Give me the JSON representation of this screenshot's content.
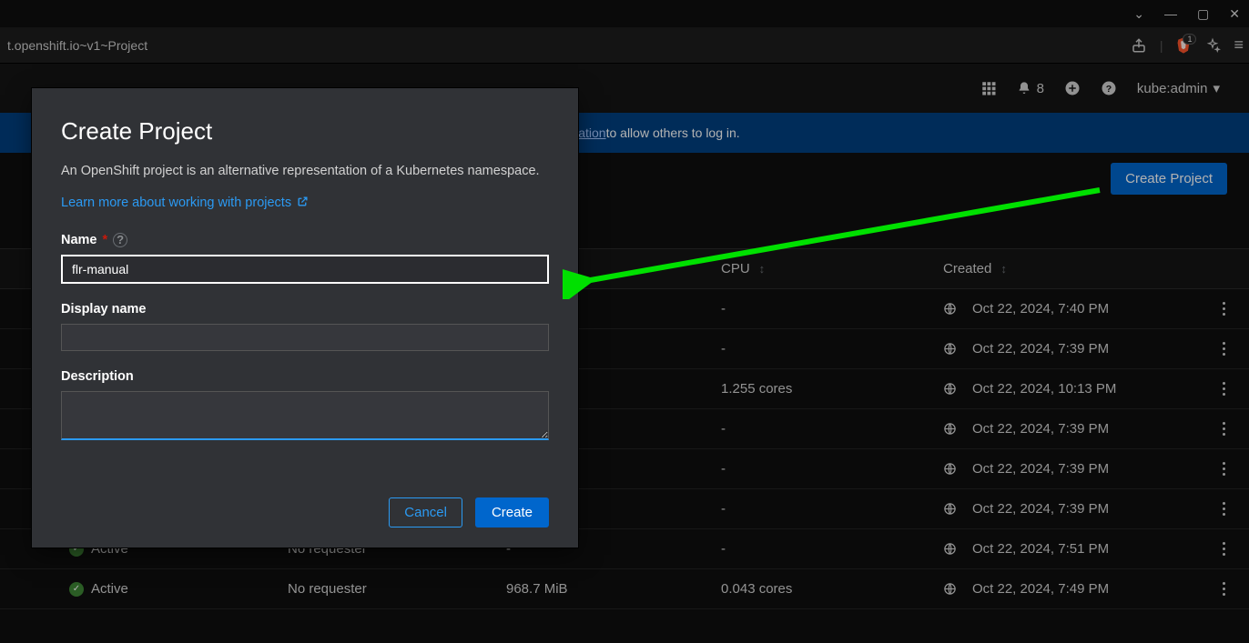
{
  "browser": {
    "url_fragment": "t.openshift.io~v1~Project"
  },
  "topbar": {
    "notifications_count": "8",
    "user_label": "kube:admin"
  },
  "infobar": {
    "link_fragment": "figuration",
    "suffix": " to allow others to log in."
  },
  "page_actions": {
    "create_project": "Create Project"
  },
  "table": {
    "columns": {
      "cpu": "CPU",
      "created": "Created"
    },
    "rows": [
      {
        "status": "",
        "requester": "",
        "memory": "",
        "cpu": "-",
        "created": "Oct 22, 2024, 7:40 PM"
      },
      {
        "status": "",
        "requester": "",
        "memory": "",
        "cpu": "-",
        "created": "Oct 22, 2024, 7:39 PM"
      },
      {
        "status": "",
        "requester": "",
        "memory": "",
        "cpu": "1.255 cores",
        "created": "Oct 22, 2024, 10:13 PM"
      },
      {
        "status": "",
        "requester": "",
        "memory": "",
        "cpu": "-",
        "created": "Oct 22, 2024, 7:39 PM"
      },
      {
        "status": "",
        "requester": "",
        "memory": "",
        "cpu": "-",
        "created": "Oct 22, 2024, 7:39 PM"
      },
      {
        "status": "",
        "requester": "",
        "memory": "",
        "cpu": "-",
        "created": "Oct 22, 2024, 7:39 PM"
      },
      {
        "status": "Active",
        "requester": "No requester",
        "memory": "-",
        "cpu": "-",
        "created": "Oct 22, 2024, 7:51 PM"
      },
      {
        "status": "Active",
        "requester": "No requester",
        "memory": "968.7 MiB",
        "cpu": "0.043 cores",
        "created": "Oct 22, 2024, 7:49 PM"
      }
    ]
  },
  "modal": {
    "title": "Create Project",
    "description": "An OpenShift project is an alternative representation of a Kubernetes namespace.",
    "learn_more": "Learn more about working with projects",
    "name_label": "Name",
    "name_value": "flr-manual",
    "display_label": "Display name",
    "display_value": "",
    "desc_label": "Description",
    "desc_value": "",
    "cancel": "Cancel",
    "create": "Create"
  }
}
